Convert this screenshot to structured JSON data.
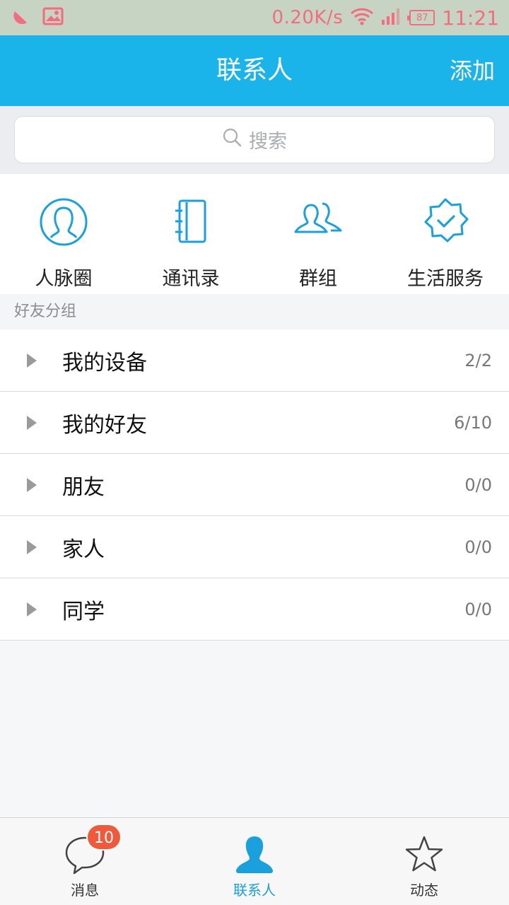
{
  "status_bar": {
    "net_speed": "0.20K/s",
    "battery": "87",
    "time": "11:21",
    "icons": [
      "app-notification-icon",
      "image-icon",
      "wifi-icon",
      "signal-icon",
      "battery-icon"
    ]
  },
  "header": {
    "title": "联系人",
    "add_label": "添加"
  },
  "search": {
    "placeholder": "搜索"
  },
  "quick_actions": [
    {
      "label": "人脉圈",
      "icon": "contact-circle-icon"
    },
    {
      "label": "通讯录",
      "icon": "address-book-icon"
    },
    {
      "label": "群组",
      "icon": "group-icon"
    },
    {
      "label": "生活服务",
      "icon": "verified-badge-icon"
    }
  ],
  "section": {
    "title": "好友分组"
  },
  "groups": [
    {
      "name": "我的设备",
      "count": "2/2"
    },
    {
      "name": "我的好友",
      "count": "6/10"
    },
    {
      "name": "朋友",
      "count": "0/0"
    },
    {
      "name": "家人",
      "count": "0/0"
    },
    {
      "name": "同学",
      "count": "0/0"
    }
  ],
  "bottom_nav": {
    "items": [
      {
        "label": "消息",
        "icon": "chat-bubble-icon",
        "badge": "10"
      },
      {
        "label": "联系人",
        "icon": "person-icon",
        "active": true
      },
      {
        "label": "动态",
        "icon": "star-icon"
      }
    ]
  },
  "colors": {
    "accent": "#1ab4ea",
    "status_bar_bg": "#c7d3c3",
    "status_text": "#f26d7d",
    "badge": "#f05a3a"
  }
}
